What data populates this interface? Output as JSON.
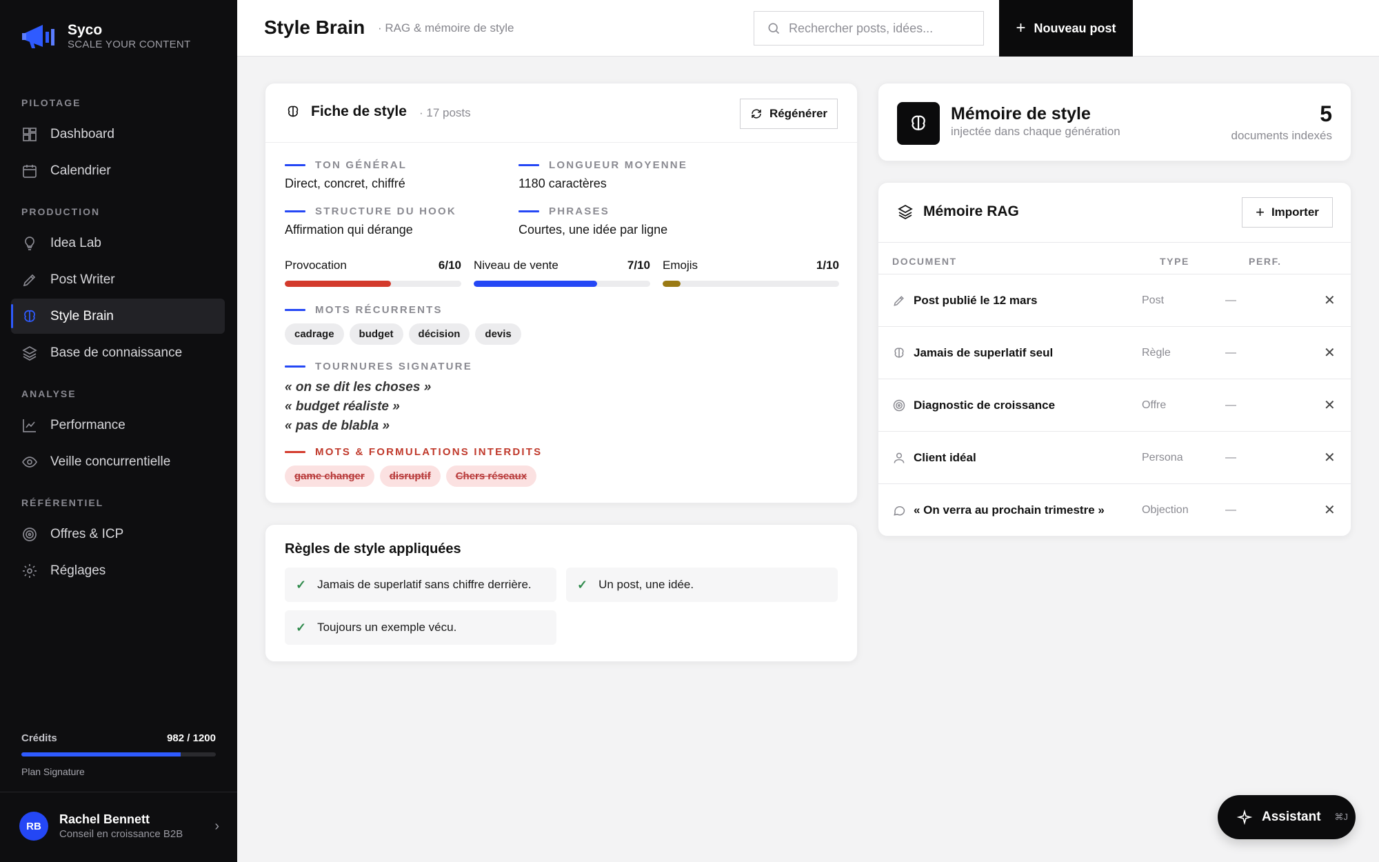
{
  "brand": {
    "name": "Syco",
    "tagline": "SCALE YOUR CONTENT"
  },
  "sidebar": {
    "sections": [
      "PILOTAGE",
      "PRODUCTION",
      "ANALYSE",
      "RÉFÉRENTIEL"
    ],
    "items": [
      {
        "label": "Dashboard",
        "icon": "dashboard-icon"
      },
      {
        "label": "Calendrier",
        "icon": "calendar-icon"
      },
      {
        "label": "Idea Lab",
        "icon": "lightbulb-icon"
      },
      {
        "label": "Post Writer",
        "icon": "pen-icon"
      },
      {
        "label": "Style Brain",
        "icon": "brain-icon",
        "active": true
      },
      {
        "label": "Base de connaissance",
        "icon": "layers-icon"
      },
      {
        "label": "Performance",
        "icon": "chart-icon"
      },
      {
        "label": "Veille concurrentielle",
        "icon": "eye-icon"
      },
      {
        "label": "Offres & ICP",
        "icon": "target-icon"
      },
      {
        "label": "Réglages",
        "icon": "gear-icon"
      }
    ],
    "credits": {
      "label": "Crédits",
      "value": "982 / 1200",
      "fraction": 0.818,
      "plan": "Plan Signature"
    },
    "user": {
      "initials": "RB",
      "name": "Rachel Bennett",
      "role": "Conseil en croissance B2B"
    }
  },
  "header": {
    "title": "Style Brain",
    "subtitle": "· RAG & mémoire de style",
    "search_placeholder": "Rechercher posts, idées...",
    "new_post_label": "Nouveau post"
  },
  "style_sheet": {
    "title": "Fiche de style",
    "count": "· 17 posts",
    "regenerate_label": "Régénérer",
    "fields": [
      {
        "label": "TON GÉNÉRAL",
        "value": "Direct, concret, chiffré"
      },
      {
        "label": "LONGUEUR MOYENNE",
        "value": "1180 caractères"
      },
      {
        "label": "STRUCTURE DU HOOK",
        "value": "Affirmation qui dérange"
      },
      {
        "label": "PHRASES",
        "value": "Courtes, une idée par ligne"
      }
    ],
    "meters": [
      {
        "label": "Provocation",
        "value": "6/10",
        "fraction": 0.6,
        "color": "#d33a2c"
      },
      {
        "label": "Niveau de vente",
        "value": "7/10",
        "fraction": 0.7,
        "color": "#2447f5"
      },
      {
        "label": "Emojis",
        "value": "1/10",
        "fraction": 0.1,
        "color": "#9a7a14"
      }
    ],
    "recurring_label": "MOTS RÉCURRENTS",
    "recurring_words": [
      "cadrage",
      "budget",
      "décision",
      "devis"
    ],
    "signature_label": "TOURNURES SIGNATURE",
    "signature_phrases": [
      "« on se dit les choses »",
      "« budget réaliste »",
      "« pas de blabla »"
    ],
    "banned_label": "MOTS & FORMULATIONS INTERDITS",
    "banned_words": [
      "game changer",
      "disruptif",
      "Chers réseaux"
    ]
  },
  "rules": {
    "title": "Règles de style appliquées",
    "items": [
      "Jamais de superlatif sans chiffre derrière.",
      "Un post, une idée.",
      "Toujours un exemple vécu."
    ]
  },
  "memory": {
    "title": "Mémoire de style",
    "subtitle": "injectée dans chaque génération",
    "count": "5",
    "count_label": "documents indexés"
  },
  "rag": {
    "title": "Mémoire RAG",
    "import_label": "Importer",
    "columns": [
      "DOCUMENT",
      "TYPE",
      "PERF."
    ],
    "rows": [
      {
        "doc": "Post publié le 12 mars",
        "type": "Post",
        "perf": "—",
        "icon": "pen-icon"
      },
      {
        "doc": "Jamais de superlatif seul",
        "type": "Règle",
        "perf": "—",
        "icon": "brain-icon"
      },
      {
        "doc": "Diagnostic de croissance",
        "type": "Offre",
        "perf": "—",
        "icon": "target-icon"
      },
      {
        "doc": "Client idéal",
        "type": "Persona",
        "perf": "—",
        "icon": "user-icon"
      },
      {
        "doc": "« On verra au prochain trimestre »",
        "type": "Objection",
        "perf": "—",
        "icon": "chat-icon"
      }
    ]
  },
  "assistant": {
    "label": "Assistant",
    "shortcut": "⌘J"
  }
}
